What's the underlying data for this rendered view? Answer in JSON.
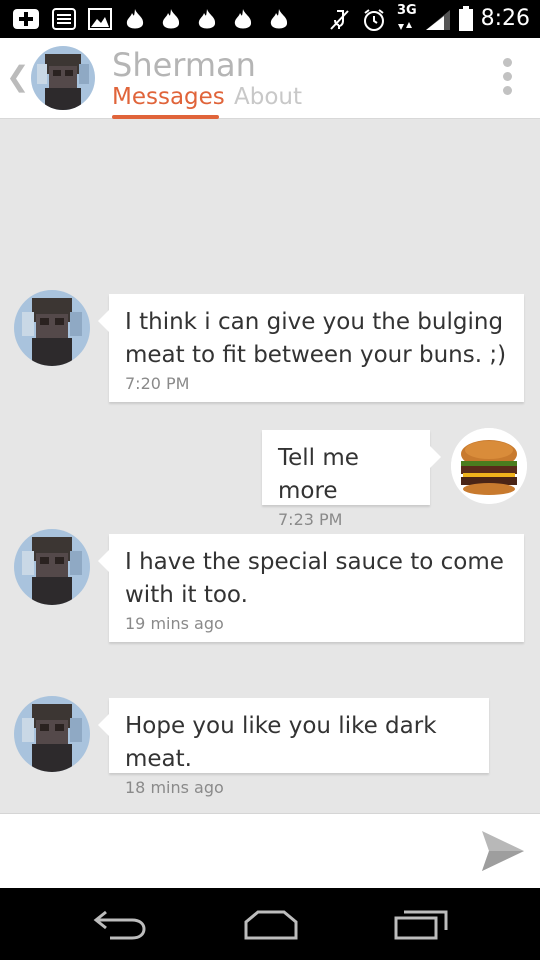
{
  "status_bar": {
    "time": "8:26",
    "network": "3G",
    "icons": [
      "plus-icon",
      "news-icon",
      "image-icon",
      "flame-icon",
      "flame-icon",
      "flame-icon",
      "flame-icon",
      "flame-icon",
      "mute-icon",
      "alarm-icon",
      "network-3g-icon",
      "signal-icon",
      "battery-icon"
    ]
  },
  "header": {
    "contact_name": "Sherman",
    "tabs": [
      {
        "label": "Messages",
        "active": true
      },
      {
        "label": "About",
        "active": false
      }
    ]
  },
  "messages": [
    {
      "from": "them",
      "text": "I think i can give you the bulging meat to fit between your buns. ;)",
      "time": "7:20 PM"
    },
    {
      "from": "me",
      "text": "Tell me more",
      "time": "7:23 PM"
    },
    {
      "from": "them",
      "text": "I have the special sauce to come with it too.",
      "time": "19 mins ago"
    },
    {
      "from": "them",
      "text": "Hope you like you like dark meat.",
      "time": "18 mins ago"
    }
  ],
  "colors": {
    "accent": "#e0643a",
    "chat_background": "#e6e6e6",
    "bubble": "#ffffff"
  }
}
